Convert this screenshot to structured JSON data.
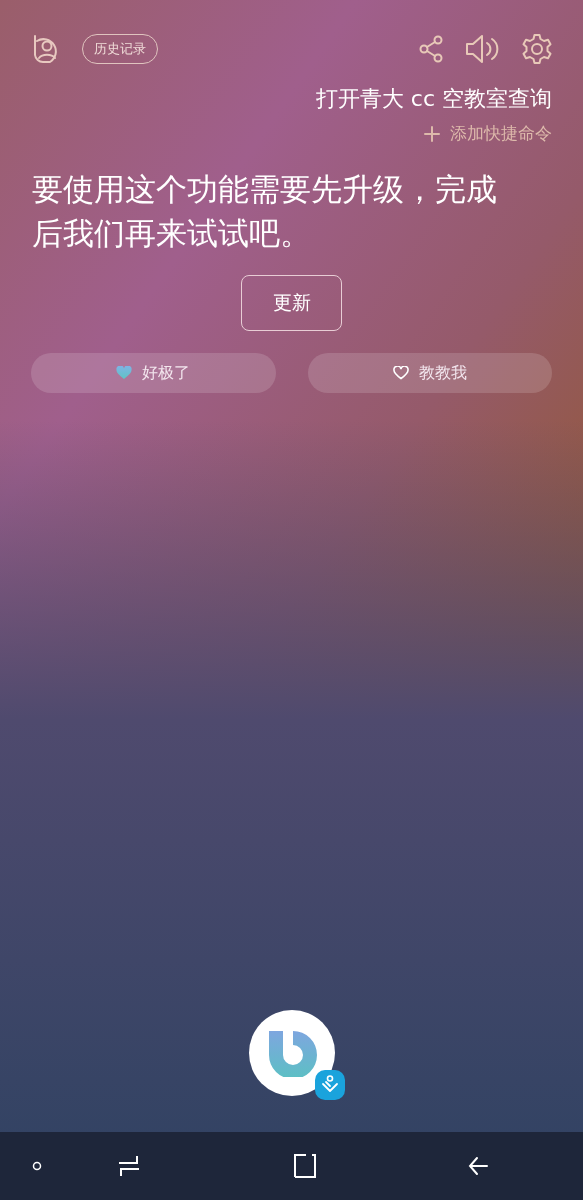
{
  "header": {
    "history_button": "历史记录"
  },
  "command": {
    "text": "打开青大 cc 空教室查询",
    "add_shortcut": "添加快捷命令"
  },
  "response": {
    "message": "要使用这个功能需要先升级，完成后我们再来试试吧。",
    "action_button": "更新"
  },
  "feedback": [
    {
      "kind": "great",
      "label": "好极了"
    },
    {
      "kind": "teach",
      "label": "教教我"
    }
  ]
}
